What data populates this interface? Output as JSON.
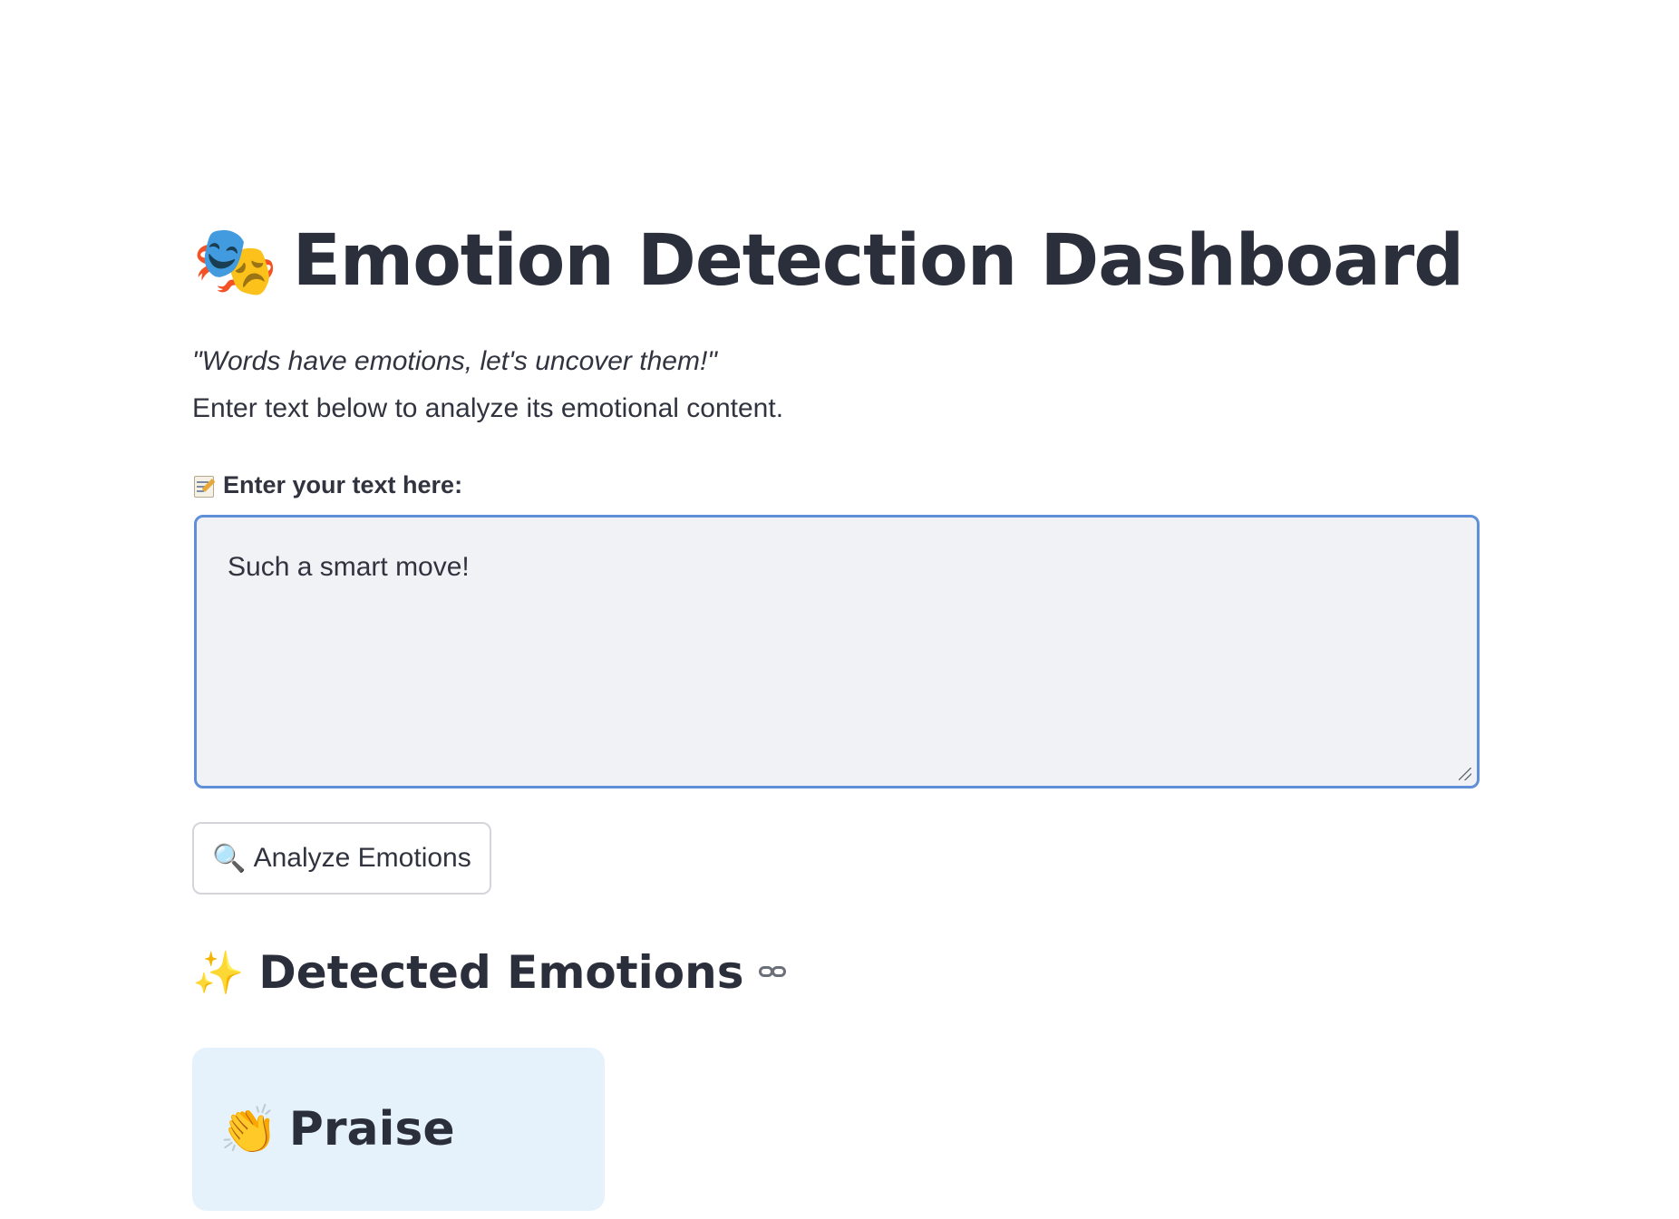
{
  "header": {
    "title_emoji": "🎭",
    "title": "Emotion Detection Dashboard",
    "quote": "\"Words have emotions, let's uncover them!\"",
    "intro": "Enter text below to analyze its emotional content."
  },
  "input": {
    "label": "Enter your text here:",
    "label_icon": "memo-icon",
    "value": "Such a smart move!"
  },
  "actions": {
    "analyze_icon": "🔍",
    "analyze_label": "Analyze Emotions"
  },
  "results": {
    "section_icon": "✨",
    "section_title": "Detected Emotions",
    "emotions": [
      {
        "icon": "👏",
        "label": "Praise"
      }
    ]
  },
  "colors": {
    "text": "#31333f",
    "input_border_focus": "#5f8fd8",
    "input_bg": "#f0f2f6",
    "card_bg": "#e5f2fc"
  }
}
